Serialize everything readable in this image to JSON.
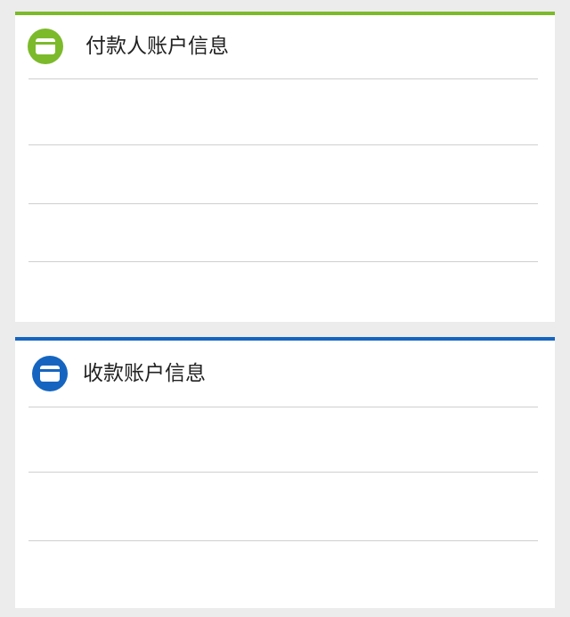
{
  "payer_section": {
    "title": "付款人账户信息",
    "icon": "card-icon",
    "accent_color": "#7cba2b",
    "rows": [
      "",
      "",
      ""
    ]
  },
  "payee_section": {
    "title": "收款账户信息",
    "icon": "card-icon",
    "accent_color": "#1565c0",
    "rows": [
      "",
      ""
    ]
  },
  "colors": {
    "background": "#ececec",
    "card": "#ffffff",
    "divider": "#cfcfcf",
    "title_text": "#222222"
  }
}
